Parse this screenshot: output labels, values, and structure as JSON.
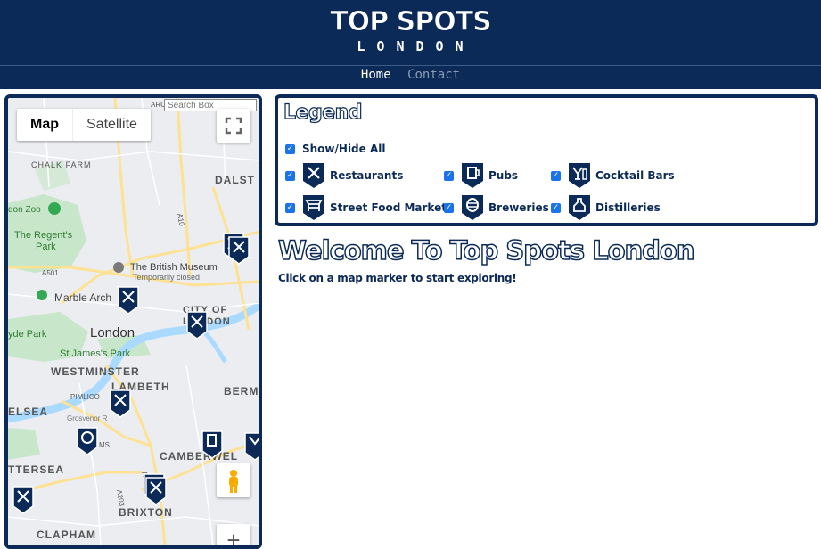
{
  "header": {
    "title": "TOP SPOTS",
    "subtitle": "LONDON",
    "nav": {
      "home": "Home",
      "contact": "Contact"
    },
    "colors": {
      "background": "#0b2a57",
      "active": "#ffffff",
      "inactive": "#8a9bb5"
    }
  },
  "map": {
    "map_type_buttons": {
      "map": "Map",
      "satellite": "Satellite"
    },
    "search_placeholder": "Search Box",
    "zoom_in_label": "+",
    "place_labels": {
      "archway": "ARCHWAY",
      "dalston": "DALST",
      "chalk_farm": "CHALK FARM",
      "london_zoo": "don Zoo",
      "regents_park_line1": "The Regent's",
      "regents_park_line2": "Park",
      "british_museum": "The British Museum",
      "british_museum_status": "Temporarily closed",
      "marble_arch": "Marble Arch",
      "city_of_london_line1": "CITY OF",
      "city_of_london_line2": "LONDON",
      "london": "London",
      "hyde_park": "yde Park",
      "st_james_park": "St James's Park",
      "westminster": "WESTMINSTER",
      "lambeth": "LAMBETH",
      "bermondsey": "BERM",
      "pimlico": "PIMLICO",
      "chelsea": "ELSEA",
      "grosvenor_road": "Grosvenor R",
      "nine_elms": "MS",
      "camberwell": "CAMBERWEL",
      "battersea": "TTERSEA",
      "brixton": "BRIXTON",
      "clapham": "CLAPHAM",
      "a501": "A501",
      "a10": "A10",
      "a3": "A3",
      "a203": "A203"
    },
    "colors": {
      "water": "#aadaff",
      "park": "#c8e6c9",
      "road": "#fde293",
      "land": "#ebedf0",
      "marker": "#0b2a57"
    }
  },
  "legend": {
    "title": "Legend",
    "show_hide_all": "Show/Hide All",
    "items": {
      "restaurants": "Restaurants",
      "pubs": "Pubs",
      "cocktail_bars": "Cocktail Bars",
      "street_food_markets": "Street Food Markets",
      "breweries": "Breweries",
      "distilleries": "Distilleries"
    },
    "checkbox_color": "#1a73e8"
  },
  "main": {
    "welcome_title": "Welcome To Top Spots London",
    "welcome_subtitle": "Click on a map marker to start exploring!"
  }
}
